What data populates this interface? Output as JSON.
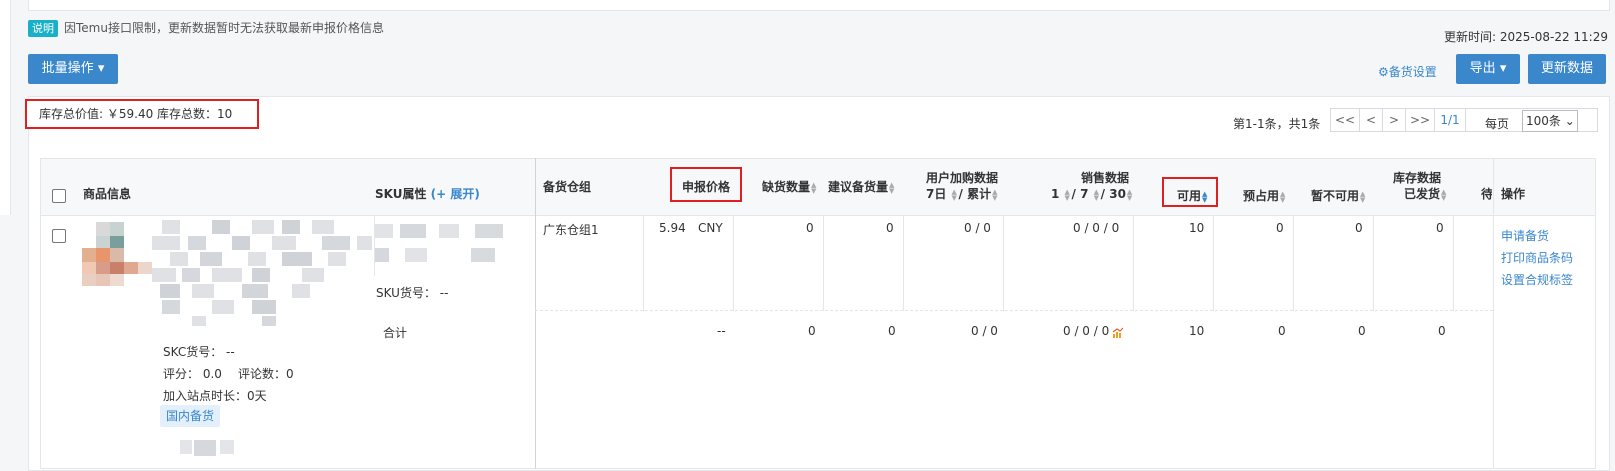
{
  "notice": {
    "badge": "说明",
    "text": "因Temu接口限制，更新数据暂时无法获取最新申报价格信息"
  },
  "update_time": "更新时间: 2025-08-22 11:29",
  "toolbar": {
    "batch_label": "批量操作",
    "stock_setting": "备货设置",
    "export_label": "导出",
    "update_label": "更新数据"
  },
  "summary": "库存总价值: ￥59.40 库存总数：10",
  "pager": {
    "info": "第1-1条，共1条",
    "first": "<<",
    "prev": "<",
    "next": ">",
    "last": ">>",
    "current": "1/1",
    "per_page_label": "每页",
    "size": "100条"
  },
  "table": {
    "headers": {
      "product": "商品信息",
      "sku": "SKU属性",
      "expand": "(+ 展开)",
      "warehouse": "备货仓组",
      "price": "申报价格",
      "short": "缺货数量",
      "suggest": "建议备货量",
      "cart_top": "用户加购数据",
      "cart_sub1": "7日",
      "cart_sub2": "/ 累计",
      "sales_top": "销售数据",
      "sales_1": "1",
      "sales_7": "/ 7",
      "sales_30": "/ 30",
      "available": "可用",
      "reserved": "预占用",
      "unavailable": "暂不可用",
      "stock_top": "库存数据",
      "stock_shipped": "已发货",
      "cut": "待",
      "ops": "操作"
    },
    "row": {
      "skc": "SKC货号： --",
      "rating": "评分： 0.0",
      "reviews": "评论数：0",
      "duration": "加入站点时长：0天",
      "tag": "国内备货",
      "sku_no": "SKU货号： --",
      "warehouse": "广东仓组1",
      "price": "5.94",
      "currency": "CNY",
      "short": "0",
      "suggest": "0",
      "cart": "0 /  0",
      "sales": "0 /  0 /  0",
      "available": "10",
      "reserved": "0",
      "unavailable": "0",
      "shipped": "0",
      "ops": [
        "申请备货",
        "打印商品条码",
        "设置合规标签"
      ]
    },
    "total": {
      "label": "合计",
      "price": "--",
      "short": "0",
      "suggest": "0",
      "cart": "0 / 0",
      "sales": "0 / 0 / 0",
      "available": "10",
      "reserved": "0",
      "unavailable": "0",
      "shipped": "0"
    }
  },
  "colors": {
    "accent": "#3a87cc",
    "highlight": "#e02020",
    "badge": "#19b0c9"
  }
}
